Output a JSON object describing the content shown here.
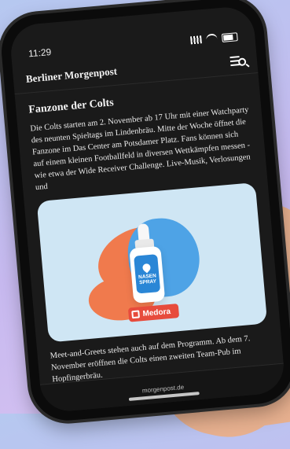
{
  "status": {
    "time": "11:29"
  },
  "header": {
    "brand": "Berliner Morgenpost"
  },
  "article": {
    "title": "Fanzone der Colts",
    "paragraph1": "Die Colts starten am 2. November ab 17 Uhr mit einer Watchparty des neunten Spieltags im Lindenbräu. Mitte der Woche öffnet die Fanzone im Das Center am Potsdamer Platz. Fans können sich auf einem kleinen Footballfeld in diversen Wettkämpfen messen - wie etwa der Wide Receiver Challenge. Live-Musik, Verlosungen und",
    "paragraph2": "Meet-and-Greets stehen auch auf dem Programm. Ab dem 7. November eröffnen die Colts einen zweiten Team-Pub im Hopfingerbräu."
  },
  "ad": {
    "product_label": "NASEN SPRAY",
    "brand": "Medora"
  },
  "footer": {
    "domain": "morgenpost.de"
  },
  "colors": {
    "ad_background": "#cfe6f4",
    "ad_orange": "#f07a4d",
    "ad_blue": "#4ea3e6",
    "ad_badge": "#e74b3c"
  },
  "icons": {
    "menu": "menu-search-icon",
    "signal": "signal-icon",
    "wifi": "wifi-icon",
    "battery": "battery-icon"
  }
}
